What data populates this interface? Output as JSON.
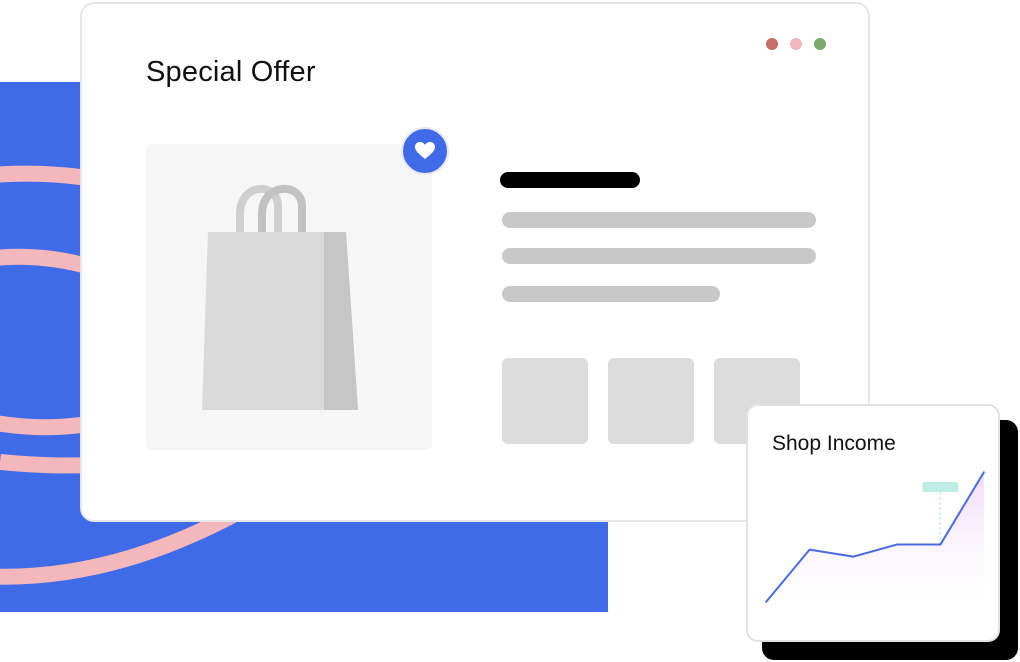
{
  "window": {
    "title": "Special Offer",
    "dots": [
      "#c96b67",
      "#f0b8bc",
      "#7aab6b"
    ]
  },
  "product": {
    "image_icon": "shopping-bag-icon",
    "favorite_icon": "heart-icon"
  },
  "income_card": {
    "title": "Shop Income"
  },
  "chart_data": {
    "type": "line",
    "title": "Shop Income",
    "xlabel": "",
    "ylabel": "",
    "x": [
      0,
      1,
      2,
      3,
      4,
      5
    ],
    "values": [
      0,
      52,
      45,
      57,
      57,
      129
    ],
    "ylim": [
      0,
      129
    ],
    "grid": false,
    "fill": "area-gradient",
    "highlight_index": 4,
    "line_color": "#4a6be0",
    "fill_color": "#f1dcf8",
    "marker_color": "#bfece5"
  },
  "colors": {
    "background_block": "#3f6ae8",
    "stripe": "#f4b8bc",
    "accent": "#3f6ae8",
    "placeholder_line": "#c8c8c8",
    "thumb": "#dcdcdc"
  }
}
